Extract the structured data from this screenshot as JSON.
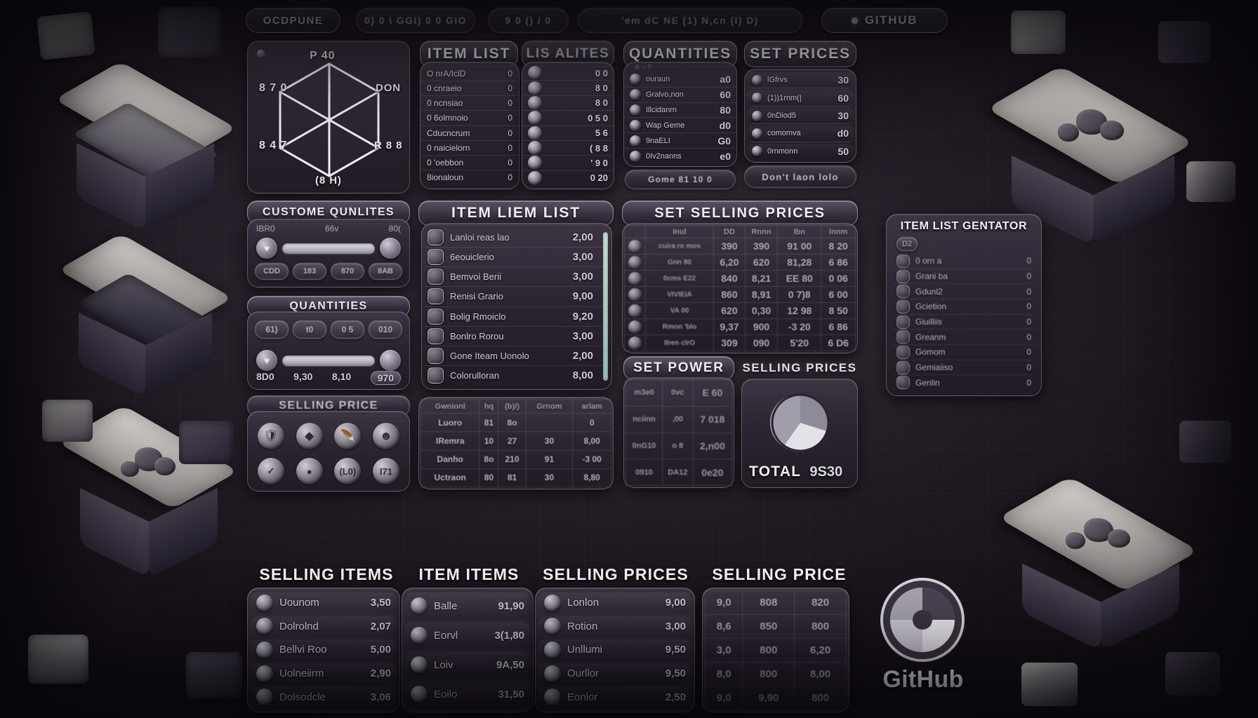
{
  "app": {
    "background_style": "dark-tiled-stone-floor",
    "accent": "#e9e7ec",
    "panel_color": "#2c2532",
    "text_color": "#e8e6ea"
  },
  "topbar": {
    "buttons": [
      {
        "label": "OCDPUNE"
      },
      {
        "label": "0) 0 \\ GGI) 0   0 GIO"
      },
      {
        "label": "9 0 ()  / 0"
      },
      {
        "label": "'em  dC NE  [1)  N,cn (I)  D)"
      }
    ],
    "github": {
      "label": "GITHUB",
      "icon": "github-dot-icon"
    }
  },
  "radar_panel": {
    "dot_icon": "panel-screw-icon",
    "labels": {
      "top": "P 40",
      "top_left": "8 7 0",
      "bottom_left": "8 4 7",
      "right": "DON",
      "bottom_right": "R 8 8",
      "bottom": "(8 H)"
    }
  },
  "item_list": {
    "title": "ITEM LIST",
    "rows": [
      {
        "label": "O nrA/IclD",
        "value": "0"
      },
      {
        "label": "0 cnraeio",
        "value": "0"
      },
      {
        "label": "0 ncnsiao",
        "value": "0"
      },
      {
        "label": "0 6olmnoio",
        "value": "0"
      },
      {
        "label": "Cducncrum",
        "value": "0"
      },
      {
        "label": "0 naicielorn",
        "value": "0"
      },
      {
        "label": "0 'oebbon",
        "value": "0"
      },
      {
        "label": "8ionaloun",
        "value": "0"
      }
    ]
  },
  "qualities_panel": {
    "title": "LIS ALITES",
    "rows": [
      {
        "icon": "coin-icon",
        "value": "0 0"
      },
      {
        "icon": "coin-icon",
        "value": "8 0"
      },
      {
        "icon": "coin-icon",
        "value": "8 0"
      },
      {
        "icon": "coin-icon",
        "value": "0 5 0"
      },
      {
        "icon": "coin-icon",
        "value": "5 6"
      },
      {
        "icon": "coin-icon",
        "value": "( 8 8"
      },
      {
        "icon": "coin-icon",
        "value": "' 9 0"
      },
      {
        "icon": "coin-icon",
        "value": "0 20"
      }
    ]
  },
  "quantities_panel": {
    "title": "QUANTITIES",
    "subtitle": "6 ~ ?",
    "rows": [
      {
        "icon": "coin-icon",
        "label": "ouraun",
        "value": "a0"
      },
      {
        "icon": "coin-icon",
        "label": "Gralvo,non",
        "value": "60"
      },
      {
        "icon": "coin-icon",
        "label": "Illcidanrn",
        "value": "80"
      },
      {
        "icon": "coin-icon",
        "label": "Wap Geme",
        "value": "d0"
      },
      {
        "icon": "coin-icon",
        "label": "9naELI",
        "value": "G0"
      },
      {
        "icon": "coin-icon",
        "label": "0Iv2nanns",
        "value": "e0"
      }
    ],
    "footer_button": {
      "label": "Gome  81 10  0"
    }
  },
  "set_prices_panel": {
    "title": "SET PRICES",
    "rows": [
      {
        "icon": "coin-icon",
        "label": "lGfrvs",
        "value": "30"
      },
      {
        "icon": "coin-icon",
        "label": "(1))1rnm(|",
        "value": "60"
      },
      {
        "icon": "coin-icon",
        "label": "0nDiod5",
        "value": "30"
      },
      {
        "icon": "coin-icon",
        "label": "comomva",
        "value": "d0"
      },
      {
        "icon": "coin-icon",
        "label": "0rnmonn",
        "value": "50"
      }
    ],
    "footer_button": {
      "label": "Don't laon lolo"
    }
  },
  "custom_qualities_panel": {
    "title": "CUSTOME QUNLITES",
    "labels": {
      "left": "IBR0",
      "mid": "66v",
      "right": "80("
    },
    "slider": {
      "handle_icon": "heart-icon",
      "value": 88
    },
    "buttons": [
      {
        "label": "CDD"
      },
      {
        "label": "183"
      },
      {
        "label": "870"
      },
      {
        "label": "8AB"
      }
    ]
  },
  "quantities_slider_panel": {
    "title": "QUANTITIES",
    "buttons": [
      {
        "label": "61)"
      },
      {
        "label": "t0"
      },
      {
        "label": "0 5"
      },
      {
        "label": "010"
      }
    ],
    "slider": {
      "handle_icon": "heart-icon",
      "value": 86
    },
    "values": [
      "8D0",
      "9,30",
      "8,10",
      "970"
    ]
  },
  "selling_panel": {
    "title": "SELLING PRICE",
    "icons_row1": [
      "shield-icon",
      "diamond-icon",
      "feather-icon",
      "face-icon"
    ],
    "icons_row2": [
      "check-icon",
      "orb-icon",
      "tag-icon",
      "coin-icon"
    ],
    "row2_labels": [
      "",
      "",
      "(L0)",
      "I71"
    ]
  },
  "item_liem_list": {
    "title": "ITEM LIEM LIST",
    "rows": [
      {
        "thumb": "item-thumb-icon",
        "label": "Lanloi reas lao",
        "price": "2,00"
      },
      {
        "thumb": "item-thumb-icon",
        "label": "6eouiclerio",
        "price": "3,00"
      },
      {
        "thumb": "item-thumb-icon",
        "label": "Bemvoi Berii",
        "price": "3,00"
      },
      {
        "thumb": "item-thumb-icon",
        "label": "Renisi Grario",
        "price": "9,00"
      },
      {
        "thumb": "item-thumb-icon",
        "label": "Bolig Rmoiclo",
        "price": "9,20"
      },
      {
        "thumb": "item-thumb-icon",
        "label": "Bonlro Rorou",
        "price": "3,00"
      },
      {
        "thumb": "item-thumb-icon",
        "label": "Gone Iteam Uonolo",
        "price": "2,00"
      },
      {
        "thumb": "item-thumb-icon",
        "label": "Colorulloran",
        "price": "8,00"
      }
    ]
  },
  "small_table": {
    "columns": [
      "Gwnionl",
      "hq",
      "(b)/)",
      "Grnom",
      "arlam"
    ],
    "rows": [
      [
        "Luoro",
        "81",
        "8o",
        "",
        "0"
      ],
      [
        "IRemra",
        "10",
        "27",
        "30",
        "8,00"
      ],
      [
        "Danho",
        "8o",
        "210",
        "91",
        "-3 00"
      ],
      [
        "Uctraon",
        "80",
        "81",
        "30",
        "8,80"
      ]
    ]
  },
  "set_selling_prices": {
    "title": "SET SELLING PRICES",
    "columns": [
      "Inul",
      "DD",
      "Rnnn",
      "Ibn",
      "lnnm"
    ],
    "rows": [
      {
        "icon": "coin-icon",
        "label": "cuira ro mos",
        "cells": [
          "390",
          "390",
          "91 00",
          "8 20"
        ]
      },
      {
        "icon": "coin-icon",
        "label": "Gnn 80",
        "cells": [
          "6,20",
          "620",
          "81,28",
          "6 86"
        ]
      },
      {
        "icon": "coin-icon",
        "label": "0cms E22",
        "cells": [
          "840",
          "8,21",
          "EE 80",
          "0 06"
        ]
      },
      {
        "icon": "coin-icon",
        "label": "VIVIEIA",
        "cells": [
          "860",
          "8,91",
          "0 7)8",
          "6 00"
        ]
      },
      {
        "icon": "coin-icon",
        "label": "VA 00",
        "cells": [
          "620",
          "0,30",
          "12 98",
          "8 50"
        ]
      },
      {
        "icon": "coin-icon",
        "label": "Rmnn 'blo",
        "cells": [
          "9,37",
          "900",
          "-3 20",
          "6 86"
        ]
      },
      {
        "icon": "coin-icon",
        "label": "Ilren clrO",
        "cells": [
          "309",
          "090",
          "5'20",
          "6 D6"
        ]
      }
    ]
  },
  "set_power_panel": {
    "title": "SET POWER",
    "rows": [
      [
        "m3e0",
        "0vc",
        "E 60"
      ],
      [
        "nciinn",
        ",00",
        "7 018"
      ],
      [
        "0nG10",
        "o 8",
        "2,n00"
      ],
      [
        "0910",
        "DA12",
        "0e20"
      ]
    ]
  },
  "selling_prices_donut_panel": {
    "title": "SELLING PRICES",
    "chart": {
      "type": "donut",
      "slices": [
        40,
        25,
        20,
        15
      ]
    },
    "total_label": "TOTAL",
    "total_value": "9S30"
  },
  "item_list_generator": {
    "title": "ITEM LIST GENTATOR",
    "badge": "D2",
    "rows": [
      {
        "label": "0 orn a",
        "value": "0"
      },
      {
        "label": "Grani ba",
        "value": "0"
      },
      {
        "label": "Gdunl2",
        "value": "0"
      },
      {
        "label": "Gcietion",
        "value": "0"
      },
      {
        "label": "Giuilliis",
        "value": "0"
      },
      {
        "label": "Greanm",
        "value": "0"
      },
      {
        "label": "Gomom",
        "value": "0"
      },
      {
        "label": "Gemiaiiso",
        "value": "0"
      },
      {
        "label": "Genlin",
        "value": "0"
      }
    ]
  },
  "bottom_sections": [
    {
      "title": "SELLING ITEMS",
      "rows": [
        {
          "icon": "pebble-icon",
          "label": "Uounom",
          "value": "3,50"
        },
        {
          "icon": "pebble-icon",
          "label": "Dolrolnd",
          "value": "2,07"
        },
        {
          "icon": "pebble-icon",
          "label": "Bellvi Roo",
          "value": "5,00"
        },
        {
          "icon": "pebble-icon",
          "label": "Uolneiirm",
          "value": "2,90"
        },
        {
          "icon": "pebble-icon",
          "label": "Dolsodcle",
          "value": "3,06"
        }
      ]
    },
    {
      "title": "ITEM ITEMS",
      "rows": [
        {
          "icon": "coin-icon",
          "label": "Balle",
          "value": "91,90"
        },
        {
          "icon": "coin-icon",
          "label": "Eorvl",
          "value": "3(1,80"
        },
        {
          "icon": "coin-icon",
          "label": "Loiv",
          "value": "9A,50"
        },
        {
          "icon": "coin-icon",
          "label": "Eoilo",
          "value": "31,50"
        }
      ]
    },
    {
      "title": "SELLING PRICES",
      "rows": [
        {
          "icon": "coin-icon",
          "label": "Lonlon",
          "value": "9,00"
        },
        {
          "icon": "coin-icon",
          "label": "Rotion",
          "value": "3,00"
        },
        {
          "icon": "coin-icon",
          "label": "Unllumi",
          "value": "9,50"
        },
        {
          "icon": "coin-icon",
          "label": "Ourllor",
          "value": "9,50"
        },
        {
          "icon": "coin-icon",
          "label": "Eonlor",
          "value": "2,50"
        }
      ]
    },
    {
      "title": "SELLING PRICE",
      "grid_rows": [
        [
          "9,0",
          "808",
          "820"
        ],
        [
          "8,6",
          "850",
          "800"
        ],
        [
          "3,0",
          "800",
          "6,20"
        ],
        [
          "8,0",
          "800",
          "8,00"
        ],
        [
          "9,0",
          "9,90",
          "800"
        ]
      ]
    }
  ],
  "github_logo": {
    "label": "GitHub",
    "icon": "github-mark-icon"
  }
}
